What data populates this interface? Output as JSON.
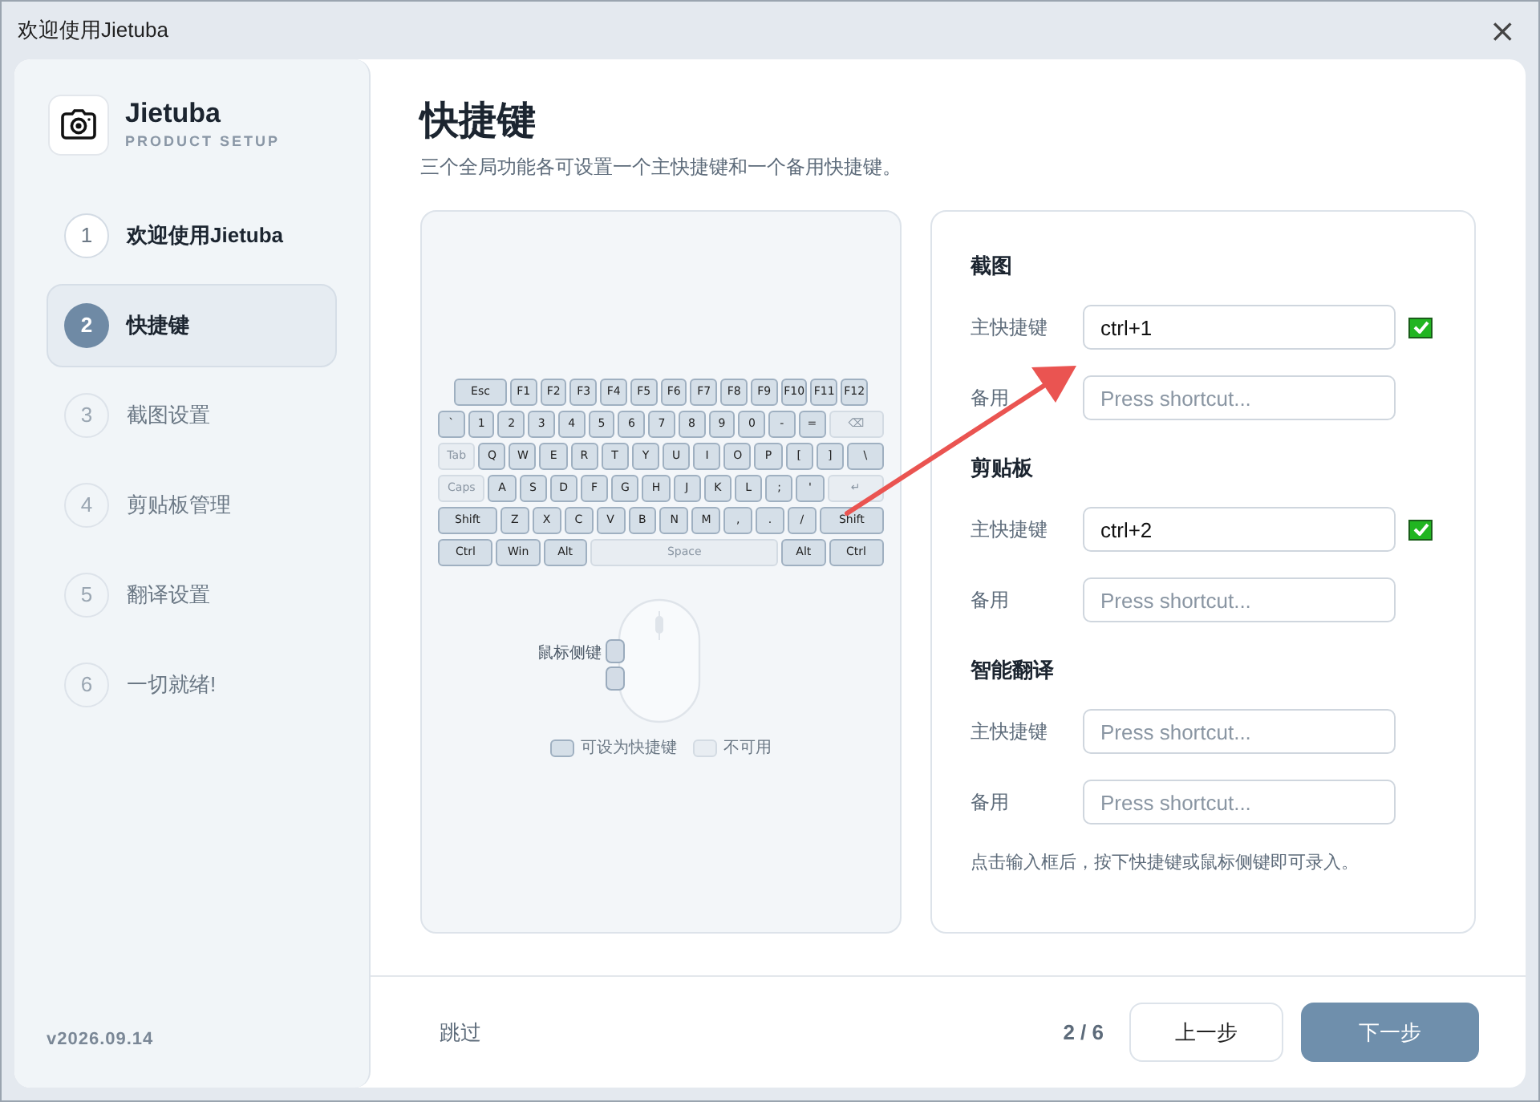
{
  "window": {
    "title": "欢迎使用Jietuba",
    "close": "×"
  },
  "sidebar": {
    "app_name": "Jietuba",
    "subtitle": "PRODUCT SETUP",
    "version": "v2026.09.14",
    "steps": [
      {
        "number": "1",
        "label": "欢迎使用Jietuba",
        "selected": false,
        "completed": true
      },
      {
        "number": "2",
        "label": "快捷键",
        "selected": true,
        "completed": false
      },
      {
        "number": "3",
        "label": "截图设置",
        "selected": false,
        "completed": false
      },
      {
        "number": "4",
        "label": "剪贴板管理",
        "selected": false,
        "completed": false
      },
      {
        "number": "5",
        "label": "翻译设置",
        "selected": false,
        "completed": false
      },
      {
        "number": "6",
        "label": "一切就绪!",
        "selected": false,
        "completed": false
      }
    ]
  },
  "page": {
    "title": "快捷键",
    "description": "三个全局功能各可设置一个主快捷键和一个备用快捷键。"
  },
  "keyboard": {
    "rows": [
      [
        {
          "label": "Esc",
          "kind": "bindable"
        },
        {
          "label": "F1",
          "kind": "bindable"
        },
        {
          "label": "F2",
          "kind": "bindable"
        },
        {
          "label": "F3",
          "kind": "bindable"
        },
        {
          "label": "F4",
          "kind": "bindable"
        },
        {
          "label": "F5",
          "kind": "bindable"
        },
        {
          "label": "F6",
          "kind": "bindable"
        },
        {
          "label": "F7",
          "kind": "bindable"
        },
        {
          "label": "F8",
          "kind": "bindable"
        },
        {
          "label": "F9",
          "kind": "bindable"
        },
        {
          "label": "F10",
          "kind": "bindable"
        },
        {
          "label": "F11",
          "kind": "bindable"
        },
        {
          "label": "F12",
          "kind": "bindable"
        }
      ],
      [
        {
          "label": "`",
          "kind": "bindable"
        },
        {
          "label": "1",
          "kind": "bindable"
        },
        {
          "label": "2",
          "kind": "bindable"
        },
        {
          "label": "3",
          "kind": "bindable"
        },
        {
          "label": "4",
          "kind": "bindable"
        },
        {
          "label": "5",
          "kind": "bindable"
        },
        {
          "label": "6",
          "kind": "bindable"
        },
        {
          "label": "7",
          "kind": "bindable"
        },
        {
          "label": "8",
          "kind": "bindable"
        },
        {
          "label": "9",
          "kind": "bindable"
        },
        {
          "label": "0",
          "kind": "bindable"
        },
        {
          "label": "-",
          "kind": "bindable"
        },
        {
          "label": "=",
          "kind": "bindable"
        },
        {
          "label": "⌫",
          "kind": "unavailable"
        }
      ],
      [
        {
          "label": "Tab",
          "kind": "unavailable"
        },
        {
          "label": "Q",
          "kind": "bindable"
        },
        {
          "label": "W",
          "kind": "bindable"
        },
        {
          "label": "E",
          "kind": "bindable"
        },
        {
          "label": "R",
          "kind": "bindable"
        },
        {
          "label": "T",
          "kind": "bindable"
        },
        {
          "label": "Y",
          "kind": "bindable"
        },
        {
          "label": "U",
          "kind": "bindable"
        },
        {
          "label": "I",
          "kind": "bindable"
        },
        {
          "label": "O",
          "kind": "bindable"
        },
        {
          "label": "P",
          "kind": "bindable"
        },
        {
          "label": "[",
          "kind": "bindable"
        },
        {
          "label": "]",
          "kind": "bindable"
        },
        {
          "label": "\\",
          "kind": "bindable"
        }
      ],
      [
        {
          "label": "Caps",
          "kind": "unavailable"
        },
        {
          "label": "A",
          "kind": "bindable"
        },
        {
          "label": "S",
          "kind": "bindable"
        },
        {
          "label": "D",
          "kind": "bindable"
        },
        {
          "label": "F",
          "kind": "bindable"
        },
        {
          "label": "G",
          "kind": "bindable"
        },
        {
          "label": "H",
          "kind": "bindable"
        },
        {
          "label": "J",
          "kind": "bindable"
        },
        {
          "label": "K",
          "kind": "bindable"
        },
        {
          "label": "L",
          "kind": "bindable"
        },
        {
          "label": ";",
          "kind": "bindable"
        },
        {
          "label": "'",
          "kind": "bindable"
        },
        {
          "label": "↵",
          "kind": "unavailable"
        }
      ],
      [
        {
          "label": "Shift",
          "kind": "bindable"
        },
        {
          "label": "Z",
          "kind": "bindable"
        },
        {
          "label": "X",
          "kind": "bindable"
        },
        {
          "label": "C",
          "kind": "bindable"
        },
        {
          "label": "V",
          "kind": "bindable"
        },
        {
          "label": "B",
          "kind": "bindable"
        },
        {
          "label": "N",
          "kind": "bindable"
        },
        {
          "label": "M",
          "kind": "bindable"
        },
        {
          "label": ",",
          "kind": "bindable"
        },
        {
          "label": ".",
          "kind": "bindable"
        },
        {
          "label": "/",
          "kind": "bindable"
        },
        {
          "label": "Shift",
          "kind": "bindable"
        }
      ],
      [
        {
          "label": "Ctrl",
          "kind": "bindable"
        },
        {
          "label": "Win",
          "kind": "bindable"
        },
        {
          "label": "Alt",
          "kind": "bindable"
        },
        {
          "label": "Space",
          "kind": "unavailable"
        },
        {
          "label": "Alt",
          "kind": "bindable"
        },
        {
          "label": "Ctrl",
          "kind": "bindable"
        }
      ]
    ],
    "mouse_label": "鼠标侧键",
    "legend": [
      {
        "label": "可设为快捷键",
        "kind": "bindable"
      },
      {
        "label": "不可用",
        "kind": "unavailable"
      }
    ]
  },
  "shortcuts": {
    "sections": [
      {
        "title": "截图",
        "fields": [
          {
            "label": "主快捷键",
            "value": "ctrl+1",
            "confirmed": true
          },
          {
            "label": "备用",
            "placeholder": "Press shortcut...",
            "confirmed": false
          }
        ]
      },
      {
        "title": "剪贴板",
        "fields": [
          {
            "label": "主快捷键",
            "value": "ctrl+2",
            "confirmed": true
          },
          {
            "label": "备用",
            "placeholder": "Press shortcut...",
            "confirmed": false
          }
        ]
      },
      {
        "title": "智能翻译",
        "fields": [
          {
            "label": "主快捷键",
            "placeholder": "Press shortcut...",
            "confirmed": false
          },
          {
            "label": "备用",
            "placeholder": "Press shortcut...",
            "confirmed": false
          }
        ]
      }
    ],
    "hint": "点击输入框后，按下快捷键或鼠标侧键即可录入。"
  },
  "footer": {
    "skip": "跳过",
    "progress": "2 / 6",
    "back": "上一步",
    "next": "下一步"
  }
}
